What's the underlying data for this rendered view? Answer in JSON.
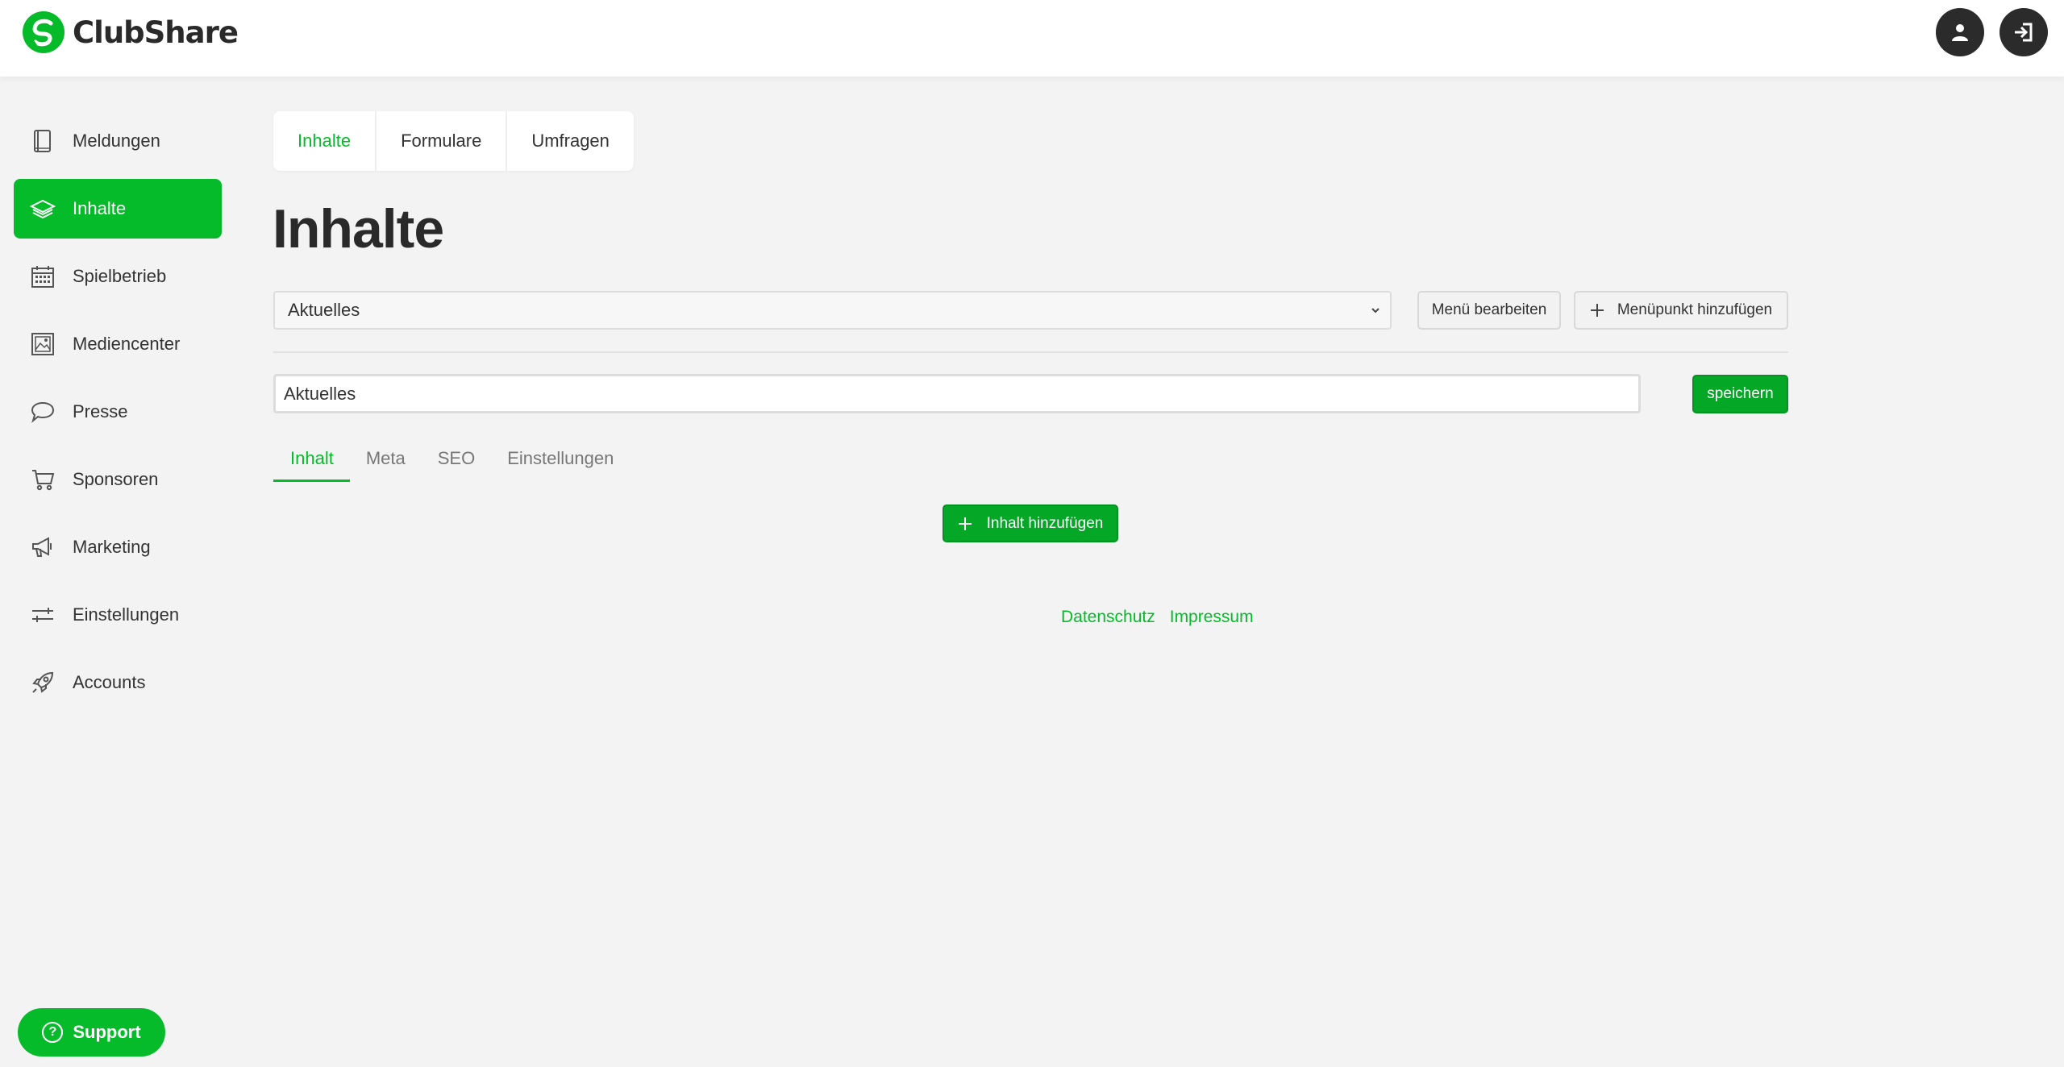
{
  "app": {
    "name": "ClubShare",
    "accent": "#05bb29",
    "dark": "#2b2b2b"
  },
  "header": {
    "icons": [
      "user-icon",
      "logout-icon"
    ]
  },
  "sidebar": {
    "items": [
      {
        "label": "Meldungen",
        "icon": "book-icon",
        "active": false
      },
      {
        "label": "Inhalte",
        "icon": "layers-icon",
        "active": true
      },
      {
        "label": "Spielbetrieb",
        "icon": "calendar-icon",
        "active": false
      },
      {
        "label": "Mediencenter",
        "icon": "image-icon",
        "active": false
      },
      {
        "label": "Presse",
        "icon": "speech-bubble-icon",
        "active": false
      },
      {
        "label": "Sponsoren",
        "icon": "cart-icon",
        "active": false
      },
      {
        "label": "Marketing",
        "icon": "megaphone-icon",
        "active": false
      },
      {
        "label": "Einstellungen",
        "icon": "sliders-icon",
        "active": false
      },
      {
        "label": "Accounts",
        "icon": "rocket-icon",
        "active": false
      }
    ]
  },
  "top_tabs": [
    {
      "label": "Inhalte",
      "active": true
    },
    {
      "label": "Formulare",
      "active": false
    },
    {
      "label": "Umfragen",
      "active": false
    }
  ],
  "page": {
    "title": "Inhalte"
  },
  "menu_select": {
    "value": "Aktuelles"
  },
  "buttons": {
    "menu_edit": "Menü bearbeiten",
    "menu_add": "Menüpunkt hinzufügen",
    "save": "speichern",
    "add_content": "Inhalt hinzufügen"
  },
  "title_input": {
    "value": "Aktuelles"
  },
  "sub_tabs": [
    {
      "label": "Inhalt",
      "active": true
    },
    {
      "label": "Meta",
      "active": false
    },
    {
      "label": "SEO",
      "active": false
    },
    {
      "label": "Einstellungen",
      "active": false
    }
  ],
  "footer": {
    "links": [
      "Datenschutz",
      "Impressum"
    ]
  },
  "support": {
    "label": "Support",
    "icon": "question-icon"
  }
}
